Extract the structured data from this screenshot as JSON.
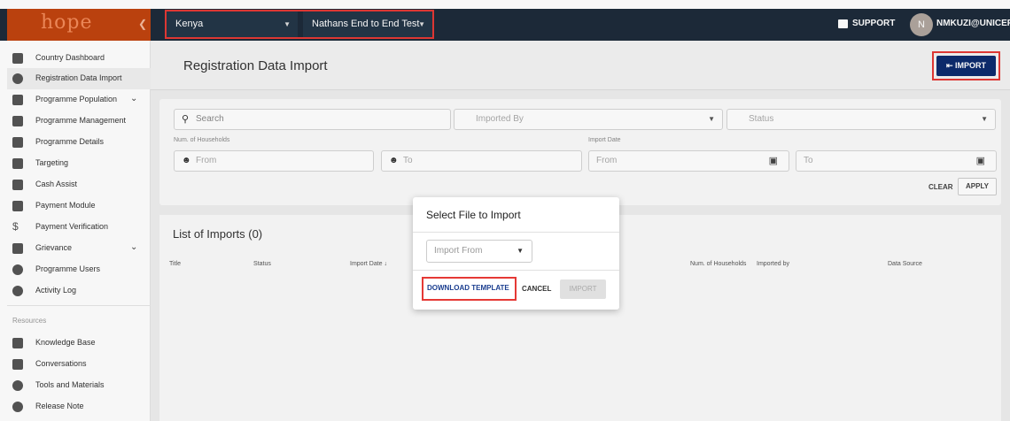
{
  "app": {
    "logo": "hope",
    "collapse_icon": "chevron-left-icon"
  },
  "topbar": {
    "country": "Kenya",
    "programme": "Nathans End to End Test",
    "support_label": "SUPPORT",
    "user_initial": "N",
    "user_email": "NMKUZI@UNICEF"
  },
  "sidebar": {
    "items": [
      {
        "label": "Country Dashboard",
        "icon": "dashboard-icon"
      },
      {
        "label": "Registration Data Import",
        "icon": "refresh-icon"
      },
      {
        "label": "Programme Population",
        "icon": "people-icon"
      },
      {
        "label": "Programme Management",
        "icon": "clipboard-icon"
      },
      {
        "label": "Programme Details",
        "icon": "clipboard-icon"
      },
      {
        "label": "Targeting",
        "icon": "target-list-icon"
      },
      {
        "label": "Cash Assist",
        "icon": "card-icon"
      },
      {
        "label": "Payment Module",
        "icon": "card-icon"
      },
      {
        "label": "Payment Verification",
        "icon": "dollar-icon"
      },
      {
        "label": "Grievance",
        "icon": "feedback-icon"
      },
      {
        "label": "Programme Users",
        "icon": "group-icon"
      },
      {
        "label": "Activity Log",
        "icon": "activity-icon"
      }
    ],
    "resources_label": "Resources",
    "resources": [
      {
        "label": "Knowledge Base",
        "icon": "book-icon"
      },
      {
        "label": "Conversations",
        "icon": "chat-icon"
      },
      {
        "label": "Tools and Materials",
        "icon": "info-icon"
      },
      {
        "label": "Release Note",
        "icon": "info-icon"
      }
    ]
  },
  "header": {
    "title": "Registration Data Import",
    "import_label": "IMPORT"
  },
  "filters": {
    "search_placeholder": "Search",
    "imported_by_placeholder": "Imported By",
    "status_placeholder": "Status",
    "num_households_label": "Num. of Households",
    "from_placeholder": "From",
    "to_placeholder": "To",
    "import_date_label": "Import Date",
    "date_from_placeholder": "From",
    "date_to_placeholder": "To",
    "clear_label": "CLEAR",
    "apply_label": "APPLY"
  },
  "list": {
    "title": "List of Imports (0)",
    "columns": [
      "Title",
      "Status",
      "Import Date",
      "Num. of Households",
      "Imported by",
      "Data Source"
    ]
  },
  "modal": {
    "title": "Select File to Import",
    "import_from_placeholder": "Import From",
    "download_label": "DOWNLOAD TEMPLATE",
    "cancel_label": "CANCEL",
    "import_label": "IMPORT"
  }
}
